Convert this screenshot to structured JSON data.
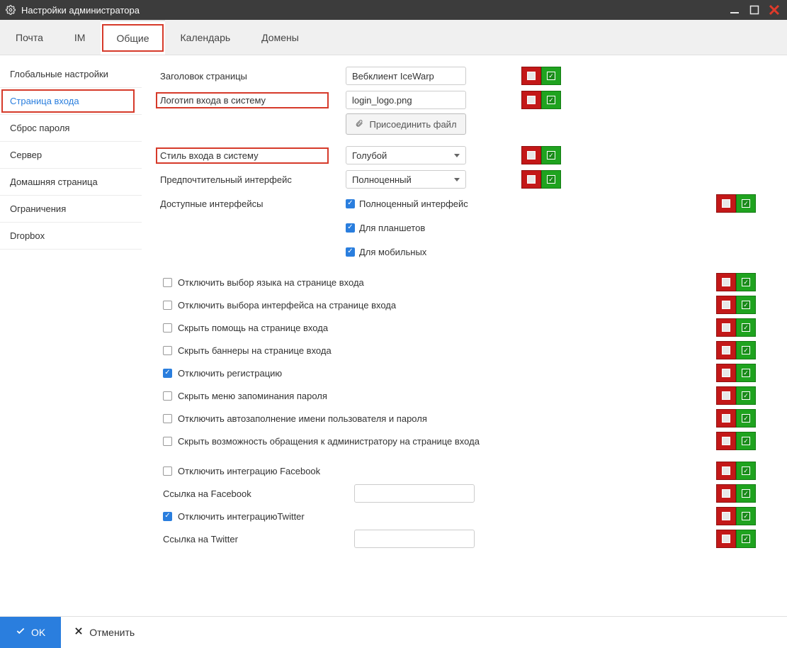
{
  "window": {
    "title": "Настройки администратора"
  },
  "tabs": {
    "items": [
      "Почта",
      "IM",
      "Общие",
      "Календарь",
      "Домены"
    ],
    "active_index": 2
  },
  "sidebar": {
    "items": [
      "Глобальные настройки",
      "Страница входа",
      "Сброс пароля",
      "Сервер",
      "Домашняя страница",
      "Ограничения",
      "Dropbox"
    ],
    "active_index": 1
  },
  "fields": {
    "page_title": {
      "label": "Заголовок страницы",
      "value": "Вебклиент IceWarp"
    },
    "login_logo": {
      "label": "Логотип входа в систему",
      "value": "login_logo.png"
    },
    "attach_file": "Присоединить файл",
    "login_style": {
      "label": "Стиль входа в систему",
      "value": "Голубой"
    },
    "pref_interface": {
      "label": "Предпочтительный интерфейс",
      "value": "Полноценный"
    },
    "avail_interfaces": {
      "label": "Доступные интерфейсы",
      "full": "Полноценный интерфейс",
      "tablet": "Для планшетов",
      "mobile": "Для мобильных"
    }
  },
  "options": {
    "disable_lang": "Отключить выбор языка на странице входа",
    "disable_iface": "Отключить выбора интерфейса на странице входа",
    "hide_help": "Скрыть помощь на странице входа",
    "hide_banners": "Скрыть баннеры на странице входа",
    "disable_register": "Отключить регистрацию",
    "hide_remember": "Скрыть меню запоминания пароля",
    "disable_autofill": "Отключить автозаполнение имени пользователя и пароля",
    "hide_admin_contact": "Скрыть возможность обращения к администратору на странице входа",
    "disable_facebook": "Отключить интеграцию Facebook",
    "facebook_link": "Ссылка на Facebook",
    "disable_twitter": "Отключить интеграциюTwitter",
    "twitter_link": "Ссылка на Twitter"
  },
  "footer": {
    "ok": "OK",
    "cancel": "Отменить"
  }
}
